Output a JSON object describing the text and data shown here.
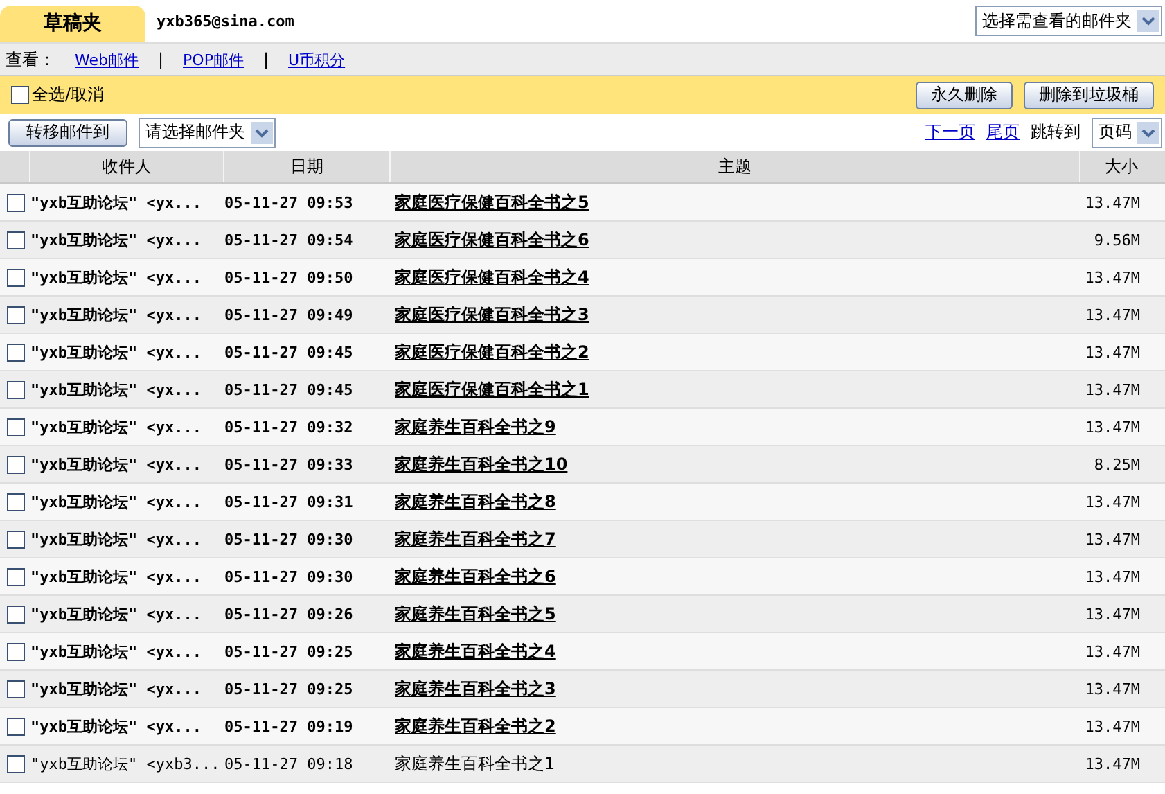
{
  "folder_tab": {
    "label": "草稿夹"
  },
  "account": "yxb365@sina.com",
  "folder_select": {
    "value": "选择需查看的邮件夹"
  },
  "view_bar": {
    "label": "查看：",
    "links": [
      "Web邮件",
      "POP邮件",
      "U币积分"
    ],
    "separator": "|"
  },
  "action_bar": {
    "select_all": {
      "label": "全选/取消",
      "checked": false
    },
    "buttons": [
      "永久删除",
      "删除到垃圾桶"
    ]
  },
  "toolbar": {
    "move_button": "转移邮件到",
    "move_select": {
      "value": "请选择邮件夹"
    },
    "next_page": "下一页",
    "last_page": "尾页",
    "jump_label": "跳转到",
    "page_select": {
      "value": "页码"
    }
  },
  "table": {
    "columns": [
      "收件人",
      "日期",
      "主题",
      "大小"
    ],
    "rows": [
      {
        "recipient": "\"yxb互助论坛\" <yx...",
        "date": "05-11-27 09:53",
        "subject": "家庭医疗保健百科全书之5",
        "size": "13.47M",
        "checked": false,
        "unread": true
      },
      {
        "recipient": "\"yxb互助论坛\" <yx...",
        "date": "05-11-27 09:54",
        "subject": "家庭医疗保健百科全书之6",
        "size": "9.56M",
        "checked": false,
        "unread": true
      },
      {
        "recipient": "\"yxb互助论坛\" <yx...",
        "date": "05-11-27 09:50",
        "subject": "家庭医疗保健百科全书之4",
        "size": "13.47M",
        "checked": false,
        "unread": true
      },
      {
        "recipient": "\"yxb互助论坛\" <yx...",
        "date": "05-11-27 09:49",
        "subject": "家庭医疗保健百科全书之3",
        "size": "13.47M",
        "checked": false,
        "unread": true
      },
      {
        "recipient": "\"yxb互助论坛\" <yx...",
        "date": "05-11-27 09:45",
        "subject": "家庭医疗保健百科全书之2",
        "size": "13.47M",
        "checked": false,
        "unread": true
      },
      {
        "recipient": "\"yxb互助论坛\" <yx...",
        "date": "05-11-27 09:45",
        "subject": "家庭医疗保健百科全书之1",
        "size": "13.47M",
        "checked": false,
        "unread": true
      },
      {
        "recipient": "\"yxb互助论坛\" <yx...",
        "date": "05-11-27 09:32",
        "subject": "家庭养生百科全书之9",
        "size": "13.47M",
        "checked": false,
        "unread": true
      },
      {
        "recipient": "\"yxb互助论坛\" <yx...",
        "date": "05-11-27 09:33",
        "subject": "家庭养生百科全书之10",
        "size": "8.25M",
        "checked": false,
        "unread": true
      },
      {
        "recipient": "\"yxb互助论坛\" <yx...",
        "date": "05-11-27 09:31",
        "subject": "家庭养生百科全书之8",
        "size": "13.47M",
        "checked": false,
        "unread": true
      },
      {
        "recipient": "\"yxb互助论坛\" <yx...",
        "date": "05-11-27 09:30",
        "subject": "家庭养生百科全书之7",
        "size": "13.47M",
        "checked": false,
        "unread": true
      },
      {
        "recipient": "\"yxb互助论坛\" <yx...",
        "date": "05-11-27 09:30",
        "subject": "家庭养生百科全书之6",
        "size": "13.47M",
        "checked": false,
        "unread": true
      },
      {
        "recipient": "\"yxb互助论坛\" <yx...",
        "date": "05-11-27 09:26",
        "subject": "家庭养生百科全书之5",
        "size": "13.47M",
        "checked": false,
        "unread": true
      },
      {
        "recipient": "\"yxb互助论坛\" <yx...",
        "date": "05-11-27 09:25",
        "subject": "家庭养生百科全书之4",
        "size": "13.47M",
        "checked": false,
        "unread": true
      },
      {
        "recipient": "\"yxb互助论坛\" <yx...",
        "date": "05-11-27 09:25",
        "subject": "家庭养生百科全书之3",
        "size": "13.47M",
        "checked": false,
        "unread": true
      },
      {
        "recipient": "\"yxb互助论坛\" <yx...",
        "date": "05-11-27 09:19",
        "subject": "家庭养生百科全书之2",
        "size": "13.47M",
        "checked": false,
        "unread": true
      },
      {
        "recipient": "\"yxb互助论坛\" <yxb3...",
        "date": "05-11-27 09:18",
        "subject": "家庭养生百科全书之1",
        "size": "13.47M",
        "checked": false,
        "unread": false
      }
    ]
  }
}
